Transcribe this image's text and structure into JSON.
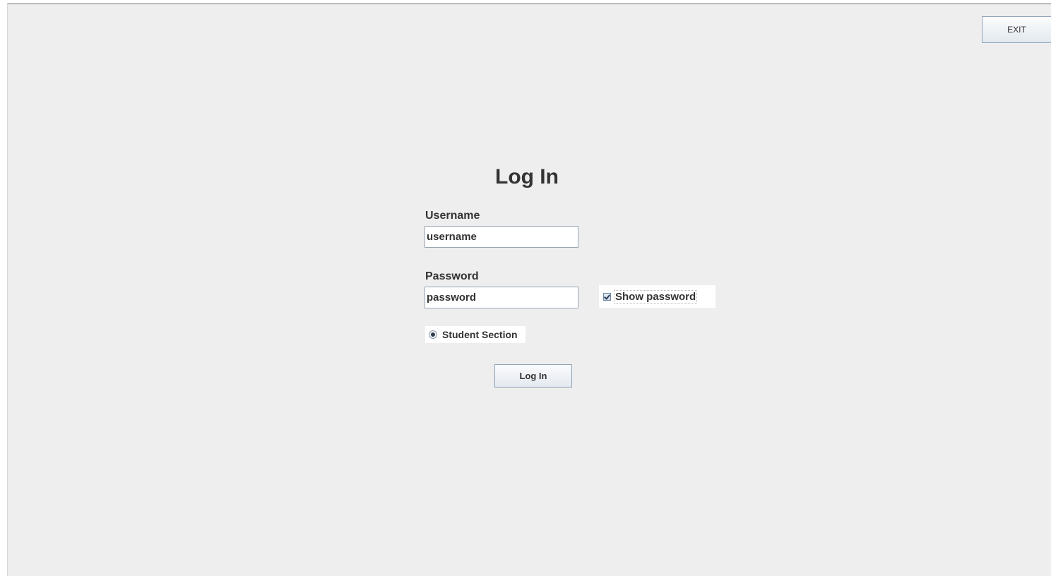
{
  "window": {
    "exit_label": "EXIT"
  },
  "login": {
    "title": "Log In",
    "username_label": "Username",
    "username_value": "username",
    "password_label": "Password",
    "password_value": "password",
    "show_password_label": "Show password",
    "show_password_checked": true,
    "student_section_label": "Student Section",
    "student_section_selected": true,
    "submit_label": "Log In"
  },
  "colors": {
    "background": "#eeeeee",
    "text": "#333333",
    "button_border": "#8fa3b8"
  }
}
